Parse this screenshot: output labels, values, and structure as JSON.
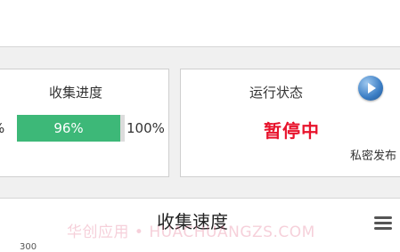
{
  "progress": {
    "title": "收集进度",
    "min_label": "%",
    "value_label": "96%",
    "value": 0.96,
    "max_label": "100%"
  },
  "status": {
    "title": "运行状态",
    "state": "暂停中",
    "play_icon": "play-icon",
    "private_label": "私密发布"
  },
  "chart": {
    "title": "收集速度",
    "watermark": "华创应用 • HUACHUANGZS.COM",
    "y_tick": "300",
    "menu_icon": "menu-icon"
  },
  "colors": {
    "progress_fill": "#3db878",
    "status_text": "#e8132c"
  }
}
